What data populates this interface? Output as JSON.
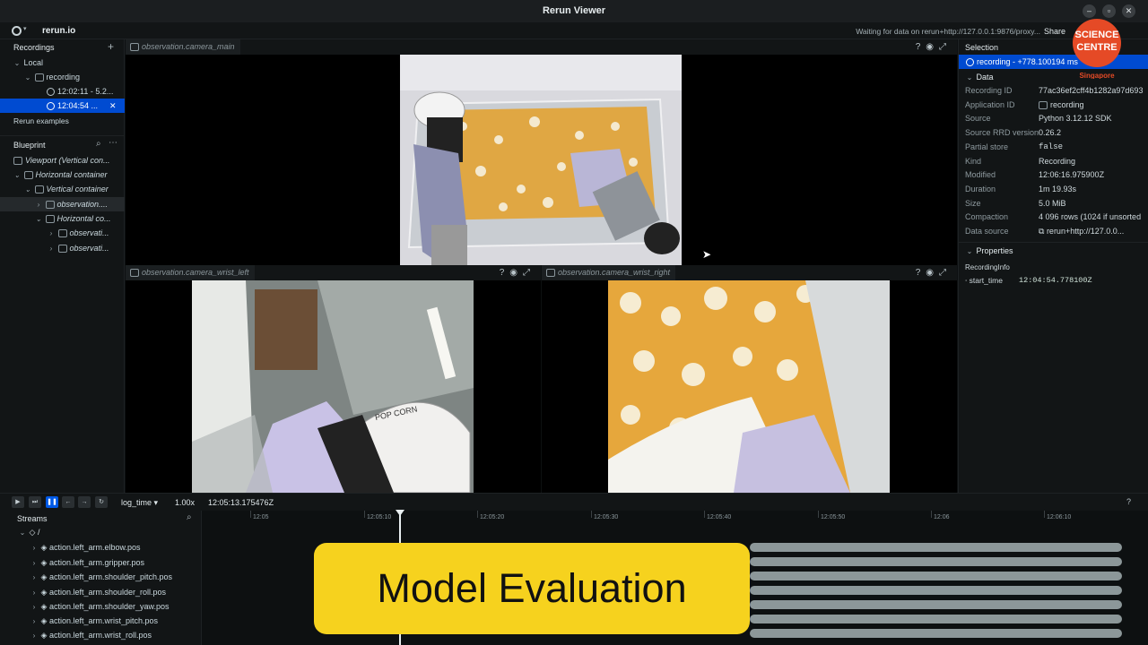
{
  "window": {
    "title": "Rerun Viewer"
  },
  "topbar": {
    "app_name": "rerun.io",
    "status": "Waiting for data on rerun+http://127.0.0.1:9876/proxy...",
    "share": "Share"
  },
  "recordings": {
    "header": "Recordings",
    "local": "Local",
    "recording": "recording",
    "items": [
      "12:02:11 - 5.2...",
      "12:04:54 ..."
    ],
    "examples": "Rerun examples"
  },
  "blueprint": {
    "header": "Blueprint",
    "items": [
      "Viewport (Vertical con...",
      "Horizontal container",
      "Vertical container",
      "observation....",
      "Horizontal co...",
      "observati...",
      "observati..."
    ]
  },
  "views": {
    "camera_main": "observation.camera_main",
    "wrist_left": "observation.camera_wrist_left",
    "wrist_right": "observation.camera_wrist_right",
    "popcorn_text": "POP CORN"
  },
  "selection": {
    "header": "Selection",
    "recording_label": "recording - +778.100194 ms",
    "data_header": "Data",
    "fields": [
      {
        "k": "Recording ID",
        "v": "77ac36ef2cff4b1282a97d693"
      },
      {
        "k": "Application ID",
        "v": "recording"
      },
      {
        "k": "Source",
        "v": "Python 3.12.12 SDK"
      },
      {
        "k": "Source RRD version",
        "v": "0.26.2"
      },
      {
        "k": "Partial store",
        "v": "false"
      },
      {
        "k": "Kind",
        "v": "Recording"
      },
      {
        "k": "Modified",
        "v": "12:06:16.975900Z"
      },
      {
        "k": "Duration",
        "v": "1m 19.93s"
      },
      {
        "k": "Size",
        "v": "5.0 MiB"
      },
      {
        "k": "Compaction",
        "v": "4 096 rows (1024 if unsorted"
      },
      {
        "k": "Data source",
        "v": "rerun+http://127.0.0..."
      }
    ],
    "properties_header": "Properties",
    "recording_info": "RecordingInfo",
    "start_time_key": "start_time",
    "start_time_val": "12:04:54.778100Z"
  },
  "logo": {
    "line1": "SCIENCE",
    "line2": "CENTRE",
    "line3": "Singapore"
  },
  "timebar": {
    "timeline": "log_time",
    "speed": "1.00x",
    "current_time": "12:05:13.175476Z"
  },
  "streams": {
    "header": "Streams",
    "root": "/",
    "items": [
      "action.left_arm.elbow.pos",
      "action.left_arm.gripper.pos",
      "action.left_arm.shoulder_pitch.pos",
      "action.left_arm.shoulder_roll.pos",
      "action.left_arm.shoulder_yaw.pos",
      "action.left_arm.wrist_pitch.pos",
      "action.left_arm.wrist_roll.pos"
    ]
  },
  "timeline": {
    "ticks": [
      "12:05",
      "12:05:10",
      "12:05:20",
      "12:05:30",
      "12:05:40",
      "12:05:50",
      "12:06",
      "12:06:10"
    ]
  },
  "banner": {
    "text": "Model Evaluation"
  },
  "colors": {
    "accent": "#004bd1",
    "banner": "#f6d21e",
    "popcorn": "#e9a93a"
  }
}
